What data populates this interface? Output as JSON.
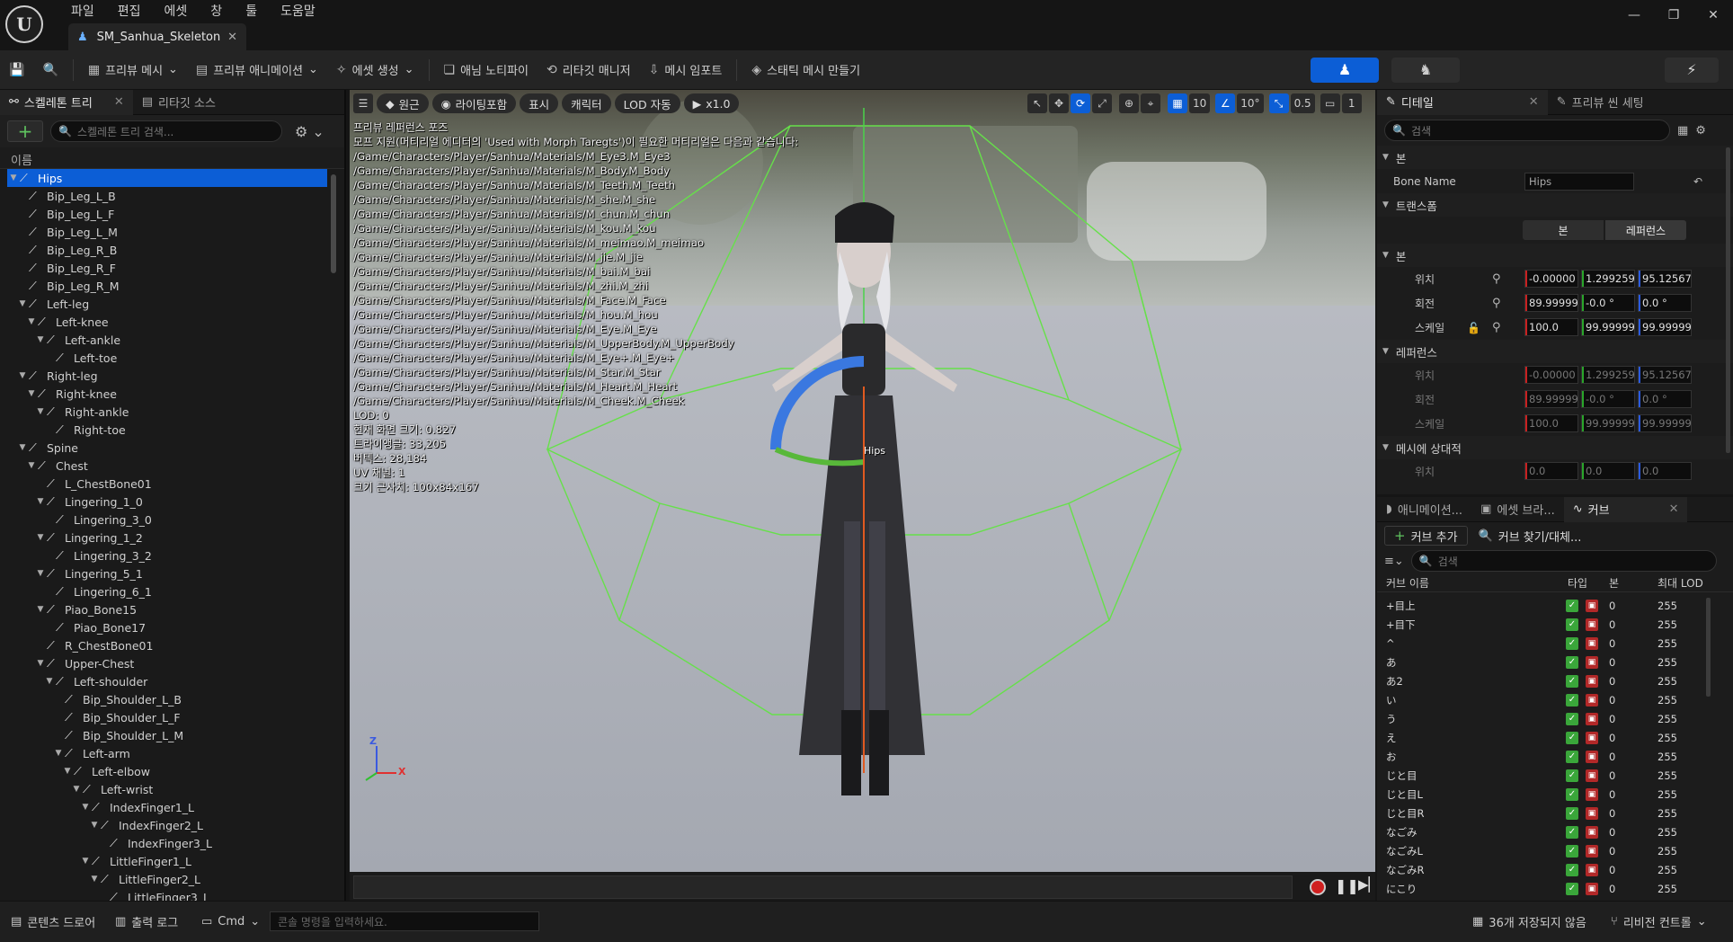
{
  "menu": [
    "파일",
    "편집",
    "에셋",
    "창",
    "툴",
    "도움말"
  ],
  "document_tab": "SM_Sanhua_Skeleton",
  "toolbar": {
    "preview_mesh": "프리뷰 메시",
    "preview_animation": "프리뷰 애니메이션",
    "create_asset": "에셋 생성",
    "anim_notify": "애님 노티파이",
    "retarget_manager": "리타깃 매니저",
    "import_mesh": "메시 임포트",
    "make_static_mesh": "스태틱 메시 만들기"
  },
  "left_panel": {
    "tab_skeleton_tree": "스켈레톤 트리",
    "tab_retarget_source": "리타깃 소스",
    "search_placeholder": "스켈레톤 트리 검색...",
    "column_name": "이름",
    "bones": [
      {
        "name": "Hips",
        "depth": 0,
        "expander": "down",
        "selected": true
      },
      {
        "name": "Bip_Leg_L_B",
        "depth": 1,
        "expander": "none"
      },
      {
        "name": "Bip_Leg_L_F",
        "depth": 1,
        "expander": "none"
      },
      {
        "name": "Bip_Leg_L_M",
        "depth": 1,
        "expander": "none"
      },
      {
        "name": "Bip_Leg_R_B",
        "depth": 1,
        "expander": "none"
      },
      {
        "name": "Bip_Leg_R_F",
        "depth": 1,
        "expander": "none"
      },
      {
        "name": "Bip_Leg_R_M",
        "depth": 1,
        "expander": "none"
      },
      {
        "name": "Left-leg",
        "depth": 1,
        "expander": "down"
      },
      {
        "name": "Left-knee",
        "depth": 2,
        "expander": "down"
      },
      {
        "name": "Left-ankle",
        "depth": 3,
        "expander": "down"
      },
      {
        "name": "Left-toe",
        "depth": 4,
        "expander": "none"
      },
      {
        "name": "Right-leg",
        "depth": 1,
        "expander": "down"
      },
      {
        "name": "Right-knee",
        "depth": 2,
        "expander": "down"
      },
      {
        "name": "Right-ankle",
        "depth": 3,
        "expander": "down"
      },
      {
        "name": "Right-toe",
        "depth": 4,
        "expander": "none"
      },
      {
        "name": "Spine",
        "depth": 1,
        "expander": "down"
      },
      {
        "name": "Chest",
        "depth": 2,
        "expander": "down"
      },
      {
        "name": "L_ChestBone01",
        "depth": 3,
        "expander": "none"
      },
      {
        "name": "Lingering_1_0",
        "depth": 3,
        "expander": "down"
      },
      {
        "name": "Lingering_3_0",
        "depth": 4,
        "expander": "none"
      },
      {
        "name": "Lingering_1_2",
        "depth": 3,
        "expander": "down"
      },
      {
        "name": "Lingering_3_2",
        "depth": 4,
        "expander": "none"
      },
      {
        "name": "Lingering_5_1",
        "depth": 3,
        "expander": "down"
      },
      {
        "name": "Lingering_6_1",
        "depth": 4,
        "expander": "none"
      },
      {
        "name": "Piao_Bone15",
        "depth": 3,
        "expander": "down"
      },
      {
        "name": "Piao_Bone17",
        "depth": 4,
        "expander": "none"
      },
      {
        "name": "R_ChestBone01",
        "depth": 3,
        "expander": "none"
      },
      {
        "name": "Upper-Chest",
        "depth": 3,
        "expander": "down"
      },
      {
        "name": "Left-shoulder",
        "depth": 4,
        "expander": "down"
      },
      {
        "name": "Bip_Shoulder_L_B",
        "depth": 5,
        "expander": "none"
      },
      {
        "name": "Bip_Shoulder_L_F",
        "depth": 5,
        "expander": "none"
      },
      {
        "name": "Bip_Shoulder_L_M",
        "depth": 5,
        "expander": "none"
      },
      {
        "name": "Left-arm",
        "depth": 5,
        "expander": "down"
      },
      {
        "name": "Left-elbow",
        "depth": 6,
        "expander": "down"
      },
      {
        "name": "Left-wrist",
        "depth": 7,
        "expander": "down"
      },
      {
        "name": "IndexFinger1_L",
        "depth": 8,
        "expander": "down"
      },
      {
        "name": "IndexFinger2_L",
        "depth": 9,
        "expander": "down"
      },
      {
        "name": "IndexFinger3_L",
        "depth": 10,
        "expander": "none"
      },
      {
        "name": "LittleFinger1_L",
        "depth": 8,
        "expander": "down"
      },
      {
        "name": "LittleFinger2_L",
        "depth": 9,
        "expander": "down"
      },
      {
        "name": "LittleFinger3_L",
        "depth": 10,
        "expander": "none"
      }
    ]
  },
  "viewport": {
    "perspective": "원근",
    "lighting": "라이팅포함",
    "show": "표시",
    "character": "캐릭터",
    "lod": "LOD 자동",
    "play_speed": "x1.0",
    "grid_size": "10",
    "angle_snap": "10°",
    "scale_snap": "0.5",
    "camera_speed": "1",
    "info_lines": [
      "프리뷰 레퍼런스 포즈",
      "모프 지원(머티리얼 에디터의 'Used with Morph Taregts')이 필요한 머티리얼은 다음과 같습니다:",
      "/Game/Characters/Player/Sanhua/Materials/M_Eye3.M_Eye3",
      "/Game/Characters/Player/Sanhua/Materials/M_Body.M_Body",
      "/Game/Characters/Player/Sanhua/Materials/M_Teeth.M_Teeth",
      "/Game/Characters/Player/Sanhua/Materials/M_she.M_she",
      "/Game/Characters/Player/Sanhua/Materials/M_chun.M_chun",
      "/Game/Characters/Player/Sanhua/Materials/M_kou.M_kou",
      "/Game/Characters/Player/Sanhua/Materials/M_meimao.M_meimao",
      "/Game/Characters/Player/Sanhua/Materials/M_jie.M_jie",
      "/Game/Characters/Player/Sanhua/Materials/M_bai.M_bai",
      "/Game/Characters/Player/Sanhua/Materials/M_zhi.M_zhi",
      "/Game/Characters/Player/Sanhua/Materials/M_Face.M_Face",
      "/Game/Characters/Player/Sanhua/Materials/M_hou.M_hou",
      "/Game/Characters/Player/Sanhua/Materials/M_Eye.M_Eye",
      "/Game/Characters/Player/Sanhua/Materials/M_UpperBody.M_UpperBody",
      "/Game/Characters/Player/Sanhua/Materials/M_Eye+.M_Eye+",
      "/Game/Characters/Player/Sanhua/Materials/M_Star.M_Star",
      "/Game/Characters/Player/Sanhua/Materials/M_Heart.M_Heart",
      "/Game/Characters/Player/Sanhua/Materials/M_Cheek.M_Cheek",
      "LOD: 0",
      "현재 화면 크기: 0.827",
      "트라이앵글: 33,205",
      "버텍스: 28,184",
      "UV 채널: 1",
      "크기 근사치: 100x84x167"
    ],
    "bone_label": "Hips",
    "axis_z": "Z",
    "axis_x": "X"
  },
  "details": {
    "tab_details": "디테일",
    "tab_preview_scene": "프리뷰 씬 세팅",
    "search_placeholder": "검색",
    "section_bone": "본",
    "bone_name_label": "Bone Name",
    "bone_name_value": "Hips",
    "section_transform": "트랜스폼",
    "toggle_bone": "본",
    "toggle_reference": "레퍼런스",
    "subsection_bone": "본",
    "subsection_reference": "레퍼런스",
    "subsection_mesh_relative": "메시에 상대적",
    "label_location": "위치",
    "label_rotation": "회전",
    "label_scale": "스케일",
    "bone_location": [
      "-0.00000",
      "1.299259",
      "95.125675"
    ],
    "bone_rotation": [
      "89.999999",
      "-0.0 °",
      "0.0 °"
    ],
    "bone_scale": [
      "100.0",
      "99.999999",
      "99.999999"
    ],
    "ref_location": [
      "-0.00000",
      "1.299259",
      "95.125675"
    ],
    "ref_rotation": [
      "89.999999",
      "-0.0 °",
      "0.0 °"
    ],
    "ref_scale": [
      "100.0",
      "99.999999",
      "99.999999"
    ],
    "mesh_location": [
      "0.0",
      "0.0",
      "0.0"
    ]
  },
  "curves": {
    "tab_animation": "애니메이션...",
    "tab_asset_browser": "에셋 브라...",
    "tab_curve": "커브",
    "add_curve": "커브 추가",
    "find_replace": "커브 찾기/대체...",
    "search_placeholder": "검색",
    "col_name": "커브 이름",
    "col_type": "타입",
    "col_bone": "본",
    "col_max_lod": "최대 LOD",
    "rows": [
      {
        "name": "+目上",
        "bone": "0",
        "lod": "255"
      },
      {
        "name": "+目下",
        "bone": "0",
        "lod": "255"
      },
      {
        "name": "^",
        "bone": "0",
        "lod": "255"
      },
      {
        "name": "あ",
        "bone": "0",
        "lod": "255"
      },
      {
        "name": "あ2",
        "bone": "0",
        "lod": "255"
      },
      {
        "name": "い",
        "bone": "0",
        "lod": "255"
      },
      {
        "name": "う",
        "bone": "0",
        "lod": "255"
      },
      {
        "name": "え",
        "bone": "0",
        "lod": "255"
      },
      {
        "name": "お",
        "bone": "0",
        "lod": "255"
      },
      {
        "name": "じと目",
        "bone": "0",
        "lod": "255"
      },
      {
        "name": "じと目L",
        "bone": "0",
        "lod": "255"
      },
      {
        "name": "じと目R",
        "bone": "0",
        "lod": "255"
      },
      {
        "name": "なごみ",
        "bone": "0",
        "lod": "255"
      },
      {
        "name": "なごみL",
        "bone": "0",
        "lod": "255"
      },
      {
        "name": "なごみR",
        "bone": "0",
        "lod": "255"
      },
      {
        "name": "にこり",
        "bone": "0",
        "lod": "255"
      }
    ]
  },
  "statusbar": {
    "content_drawer": "콘텐츠 드로어",
    "output_log": "출력 로그",
    "cmd": "Cmd",
    "console_placeholder": "콘솔 명령을 입력하세요.",
    "unsaved": "36개 저장되지 않음",
    "revision_control": "리비전 컨트롤"
  },
  "colors": {
    "accent": "#0c5ed6",
    "selection": "#0c5ed6",
    "bounds": "#66e04a",
    "gizmo_blue": "#3a78e0",
    "gizmo_green": "#58b83a",
    "gizmo_red": "#e05a20"
  }
}
